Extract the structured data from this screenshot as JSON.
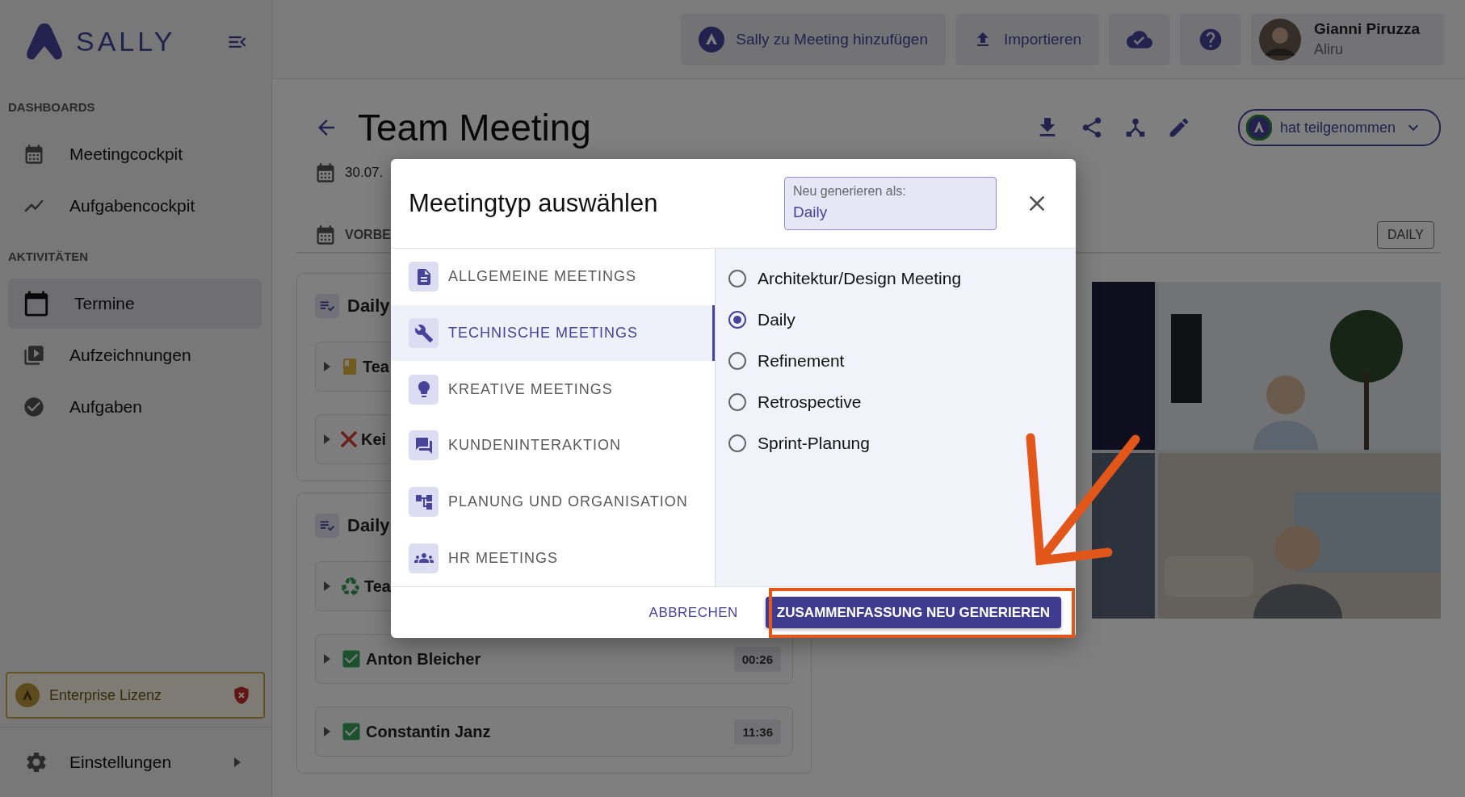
{
  "sidebar": {
    "logo": "SALLY",
    "sections": [
      {
        "title": "DASHBOARDS",
        "items": [
          {
            "label": "Meetingcockpit",
            "kind": "calendar",
            "selected": false
          },
          {
            "label": "Aufgabencockpit",
            "kind": "chart",
            "selected": false
          }
        ]
      },
      {
        "title": "AKTIVITÄTEN",
        "items": [
          {
            "label": "Termine",
            "kind": "event",
            "selected": true
          },
          {
            "label": "Aufzeichnungen",
            "kind": "video",
            "selected": false
          },
          {
            "label": "Aufgaben",
            "kind": "check",
            "selected": false
          }
        ]
      }
    ],
    "license": "Enterprise Lizenz",
    "settings": "Einstellungen"
  },
  "topbar": {
    "buttons": [
      {
        "kind": "sally",
        "label": "Sally zu Meeting hinzufügen"
      },
      {
        "kind": "upload",
        "label": "Importieren"
      },
      {
        "kind": "cloud"
      },
      {
        "kind": "help"
      }
    ],
    "user": {
      "name": "Gianni Piruzza",
      "org": "Aliru"
    }
  },
  "meeting": {
    "title": "Team Meeting",
    "status": "hat teilgenommen",
    "date": "30.07.",
    "tab": "VORBE",
    "type_chip": "DAILY",
    "groups": [
      {
        "title": "Daily",
        "rows": [
          {
            "kind": "notes",
            "label": "Tea"
          },
          {
            "kind": "failed",
            "label": "Kei"
          }
        ]
      },
      {
        "title": "Daily",
        "rows": [
          {
            "kind": "recycle",
            "label": "Tea"
          },
          {
            "kind": "done",
            "label": "Anton Bleicher",
            "duration": "00:26"
          },
          {
            "kind": "done",
            "label": "Constantin Janz",
            "duration": "11:36"
          }
        ]
      }
    ]
  },
  "dialog": {
    "title": "Meetingtyp auswählen",
    "field": {
      "label": "Neu generieren als:",
      "value": "Daily"
    },
    "categories": [
      {
        "kind": "doc",
        "label": "ALLGEMEINE MEETINGS",
        "selected": false
      },
      {
        "kind": "tool",
        "label": "TECHNISCHE MEETINGS",
        "selected": true
      },
      {
        "kind": "idea",
        "label": "KREATIVE MEETINGS",
        "selected": false
      },
      {
        "kind": "chat",
        "label": "KUNDENINTERAKTION",
        "selected": false
      },
      {
        "kind": "tree",
        "label": "PLANUNG UND ORGANISATION",
        "selected": false
      },
      {
        "kind": "people",
        "label": "HR MEETINGS",
        "selected": false
      }
    ],
    "options": [
      {
        "label": "Architektur/Design Meeting",
        "selected": false
      },
      {
        "label": "Daily",
        "selected": true
      },
      {
        "label": "Refinement",
        "selected": false
      },
      {
        "label": "Retrospective",
        "selected": false
      },
      {
        "label": "Sprint-Planung",
        "selected": false
      }
    ],
    "cancel": "ABBRECHEN",
    "confirm": "ZUSAMMENFASSUNG NEU GENERIEREN"
  }
}
